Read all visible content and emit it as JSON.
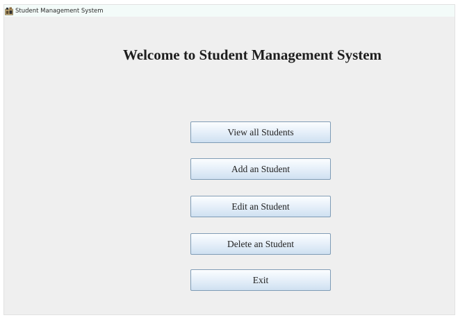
{
  "window": {
    "title": "Student Management System",
    "icon": "student-app-icon"
  },
  "main": {
    "heading": "Welcome to Student Management System"
  },
  "menu": {
    "view_all_label": "View all Students",
    "add_label": "Add an Student",
    "edit_label": "Edit an Student",
    "delete_label": "Delete an Student",
    "exit_label": "Exit"
  },
  "colors": {
    "window_background": "#efefef",
    "titlebar_background": "#f3fbf9",
    "button_gradient_top": "#fbfdff",
    "button_gradient_bottom": "#cfe0f1",
    "button_border": "#7e9bb5"
  }
}
